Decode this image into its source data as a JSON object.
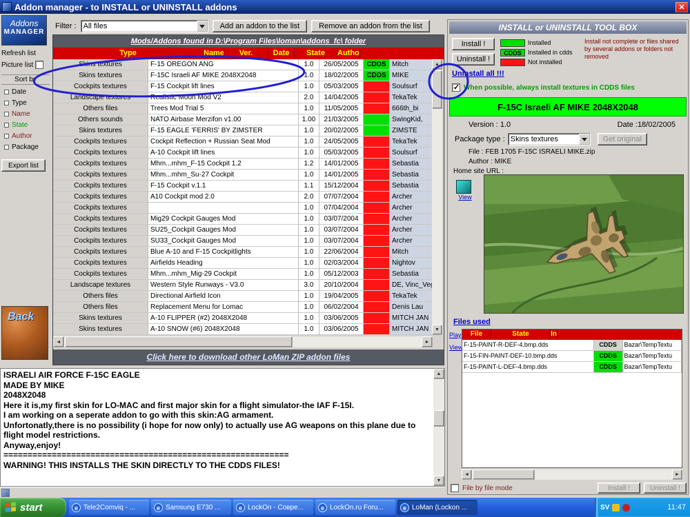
{
  "window": {
    "title": "Addon manager - to INSTALL or UNINSTALL addons",
    "close": "✕"
  },
  "sidebar": {
    "logo_line1": "Addons",
    "logo_line2": "MANAGER",
    "refresh_list": "Refresh list",
    "picture_list": "Picture list",
    "sort_by": "Sort by",
    "sort_options": [
      {
        "label": "Date",
        "color": "#000000"
      },
      {
        "label": "Type",
        "color": "#000000"
      },
      {
        "label": "Name",
        "color": "#7b2020"
      },
      {
        "label": "State",
        "color": "#00a000"
      },
      {
        "label": "Author",
        "color": "#7b2020"
      },
      {
        "label": "Package",
        "color": "#000000"
      }
    ],
    "export_list": "Export list",
    "back_label": "Back"
  },
  "toolbar": {
    "filter_label": "Filter :",
    "filter_value": "All files",
    "add_button": "Add an addon to the list",
    "remove_button": "Remove an addon from the list"
  },
  "main": {
    "header": "Mods/Addons found in D:\\Program Files\\loman\\addons_fc\\ folder",
    "columns": [
      "Type",
      "Name",
      "Ver.",
      "Date",
      "State",
      "Autho"
    ],
    "rows": [
      {
        "type": "Skins textures",
        "name": "F-15 OREGON ANG",
        "ver": "1.0",
        "date": "26/05/2005",
        "state": "CDDS",
        "state_bg": "#00e000",
        "author": "Mitch"
      },
      {
        "type": "Skins textures",
        "name": "F-15C Israeli AF MIKE 2048X2048",
        "ver": "1.0",
        "date": "18/02/2005",
        "state": "CDDS",
        "state_bg": "#00e000",
        "author": "MIKE"
      },
      {
        "type": "Cockpits textures",
        "name": "F-15 Cockpit lift lines",
        "ver": "1.0",
        "date": "05/03/2005",
        "state": "",
        "state_bg": "#ff1414",
        "author": "Soulsurf"
      },
      {
        "type": "Landscape textures",
        "name": "Realistic Moon Mod V2",
        "ver": "2.0",
        "date": "14/04/2005",
        "state": "",
        "state_bg": "#ff1414",
        "author": "TekaTek"
      },
      {
        "type": "Others files",
        "name": "Trees Mod Trial 5",
        "ver": "1.0",
        "date": "11/05/2005",
        "state": "",
        "state_bg": "#ff1414",
        "author": "666th_bi"
      },
      {
        "type": "Others sounds",
        "name": "NATO Airbase Merzifon v1.00",
        "ver": "1.00",
        "date": "21/03/2005",
        "state": "",
        "state_bg": "#00e000",
        "author": "SwingKid,"
      },
      {
        "type": "Skins textures",
        "name": "F-15 EAGLE 'FERRIS' BY ZIMSTER",
        "ver": "1.0",
        "date": "20/02/2005",
        "state": "",
        "state_bg": "#00e000",
        "author": "ZIMSTE"
      },
      {
        "type": "Cockpits textures",
        "name": "Cockpit Reflection + Russian Seat Mod",
        "ver": "1.0",
        "date": "24/05/2005",
        "state": "",
        "state_bg": "#ff1414",
        "author": "TekaTek"
      },
      {
        "type": "Cockpits textures",
        "name": "A-10 Cockpit lift lines",
        "ver": "1.0",
        "date": "05/03/2005",
        "state": "",
        "state_bg": "#ff1414",
        "author": "Soulsurf"
      },
      {
        "type": "Cockpits textures",
        "name": "Mhm...mhm_F-15 Cockpit 1.2",
        "ver": "1.2",
        "date": "14/01/2005",
        "state": "",
        "state_bg": "#ff1414",
        "author": "Sebastia"
      },
      {
        "type": "Cockpits textures",
        "name": "Mhm...mhm_Su-27 Cockpit",
        "ver": "1.0",
        "date": "14/01/2005",
        "state": "",
        "state_bg": "#ff1414",
        "author": "Sebastia"
      },
      {
        "type": "Cockpits textures",
        "name": "F-15 Cockpit v.1.1",
        "ver": "1.1",
        "date": "15/12/2004",
        "state": "",
        "state_bg": "#ff1414",
        "author": "Sebastia"
      },
      {
        "type": "Cockpits textures",
        "name": "A10 Cockpit mod 2.0",
        "ver": "2.0",
        "date": "07/07/2004",
        "state": "",
        "state_bg": "#ff1414",
        "author": "Archer"
      },
      {
        "type": "Cockpits textures",
        "name": "",
        "ver": "1.0",
        "date": "07/04/2004",
        "state": "",
        "state_bg": "#ff1414",
        "author": "Archer"
      },
      {
        "type": "Cockpits textures",
        "name": "Mig29 Cockpit Gauges Mod",
        "ver": "1.0",
        "date": "03/07/2004",
        "state": "",
        "state_bg": "#ff1414",
        "author": "Archer"
      },
      {
        "type": "Cockpits textures",
        "name": "SU25_Cockpit Gauges Mod",
        "ver": "1.0",
        "date": "03/07/2004",
        "state": "",
        "state_bg": "#ff1414",
        "author": "Archer"
      },
      {
        "type": "Cockpits textures",
        "name": "SU33_Cockpit Gauges Mod",
        "ver": "1.0",
        "date": "03/07/2004",
        "state": "",
        "state_bg": "#ff1414",
        "author": "Archer"
      },
      {
        "type": "Cockpits textures",
        "name": "Blue A-10 and F-15 Cockpitlights",
        "ver": "1.0",
        "date": "22/06/2004",
        "state": "",
        "state_bg": "#ff1414",
        "author": "Mitch"
      },
      {
        "type": "Cockpits textures",
        "name": "Airfields Heading",
        "ver": "1.0",
        "date": "02/03/2004",
        "state": "",
        "state_bg": "#ff1414",
        "author": "Nightov"
      },
      {
        "type": "Cockpits textures",
        "name": "Mhm...mhm_Mig-29 Cockpit",
        "ver": "1.0",
        "date": "05/12/2003",
        "state": "",
        "state_bg": "#ff1414",
        "author": "Sebastia"
      },
      {
        "type": "Landscape textures",
        "name": "Western Style Runways - V3.0",
        "ver": "3.0",
        "date": "20/10/2004",
        "state": "",
        "state_bg": "#ff1414",
        "author": "DE, Vinc_Vega"
      },
      {
        "type": "Others files",
        "name": "Directional Airfield Icon",
        "ver": "1.0",
        "date": "19/04/2005",
        "state": "",
        "state_bg": "#ff1414",
        "author": "TekaTek"
      },
      {
        "type": "Others files",
        "name": "Replacement Menu for Lomac",
        "ver": "1.0",
        "date": "06/02/2004",
        "state": "",
        "state_bg": "#ff1414",
        "author": "Denis Lau"
      },
      {
        "type": "Skins textures",
        "name": "A-10 FLIPPER (#2) 2048X2048",
        "ver": "1.0",
        "date": "03/06/2005",
        "state": "",
        "state_bg": "#ff1414",
        "author": "MITCH JAN"
      },
      {
        "type": "Skins textures",
        "name": "A-10 SNOW (#6) 2048X2048",
        "ver": "1.0",
        "date": "03/06/2005",
        "state": "",
        "state_bg": "#ff1414",
        "author": "MITCH JAN"
      }
    ],
    "download_link": "Click here to download other LoMan ZIP addon files"
  },
  "description": {
    "lines": [
      "ISRAELI AIR FORCE F-15C EAGLE",
      "MADE BY MIKE",
      "2048X2048",
      "Here it is,my first skin for LO-MAC and first major skin for a flight simulator-the IAF F-15I.",
      "I am working on a seperate addon to go with this skin:AG armament.",
      "Unfortonatly,there is no possibility (i hope for now only) to actually use AG weapons on this plane due to",
      "flight model restrictions.",
      "Anyway,enjoy!",
      "===========================================================",
      "WARNING! THIS INSTALLS THE SKIN DIRECTLY TO THE CDDS FILES!"
    ]
  },
  "toolbox": {
    "title": "INSTALL or UNINSTALL TOOL BOX",
    "install_button": "Install !",
    "uninstall_button": "Uninstall !",
    "uninstall_all_link": "Uninstall all !!!",
    "legend": [
      {
        "swatch": "#00e000",
        "swatch_label": "",
        "label": "Installed"
      },
      {
        "swatch": "#00e000",
        "swatch_label": "CDDS",
        "label": "Installed in cdds"
      },
      {
        "swatch": "#ff1414",
        "swatch_label": "",
        "label": "Not installed"
      }
    ],
    "legend_note": "Install not complete or files shared by several addons or folders not removed",
    "cdds_checkbox_label": "When possible, always install textures in CDDS files",
    "selected_title": "F-15C Israeli AF MIKE 2048X2048",
    "version_label": "Version : 1.0",
    "date_label": "Date :18/02/2005",
    "package_type_label": "Package type :",
    "package_type_value": "Skins textures",
    "get_original_button": "Get original",
    "file_line": "File : FEB 1705 F-15C ISRAELI MIKE.zip",
    "author_line": "Author : MIKE",
    "home_site_label": "Home site URL :",
    "view_label": "View",
    "files_used_link": "Files used",
    "play_label": "Play",
    "view2_label": "View",
    "files_columns": [
      "File",
      "State",
      "In"
    ],
    "files": [
      {
        "file": "F-15-PAINT-R-DEF-4.bmp.dds",
        "state": "CDDS",
        "state_bg": "#d6d3ce",
        "path": "Bazar\\TempTextu"
      },
      {
        "file": "F-15-FIN-PAINT-DEF-10.bmp.dds",
        "state": "CDDS",
        "state_bg": "#00e000",
        "path": "Bazar\\TempTextu"
      },
      {
        "file": "F-15-PAINT-L-DEF-4.bmp.dds",
        "state": "CDDS",
        "state_bg": "#00e000",
        "path": "Bazar\\TempTextu"
      }
    ],
    "file_by_file_label": "File by file mode",
    "install2_button": "Install !",
    "uninstall2_button": "Uninstall !"
  },
  "taskbar": {
    "start_label": "start",
    "tasks": [
      {
        "label": "Tele2Comviq - ...",
        "active": ""
      },
      {
        "label": "Samsung E730 ...",
        "active": ""
      },
      {
        "label": "LockOn - Совре...",
        "active": ""
      },
      {
        "label": "LockOn.ru Foru...",
        "active": ""
      },
      {
        "label": "LoMan (Lockon ...",
        "active": "yes"
      }
    ],
    "tray_lang": "SV",
    "tray_time": "11:47"
  },
  "annotation_color": "#2020d0"
}
